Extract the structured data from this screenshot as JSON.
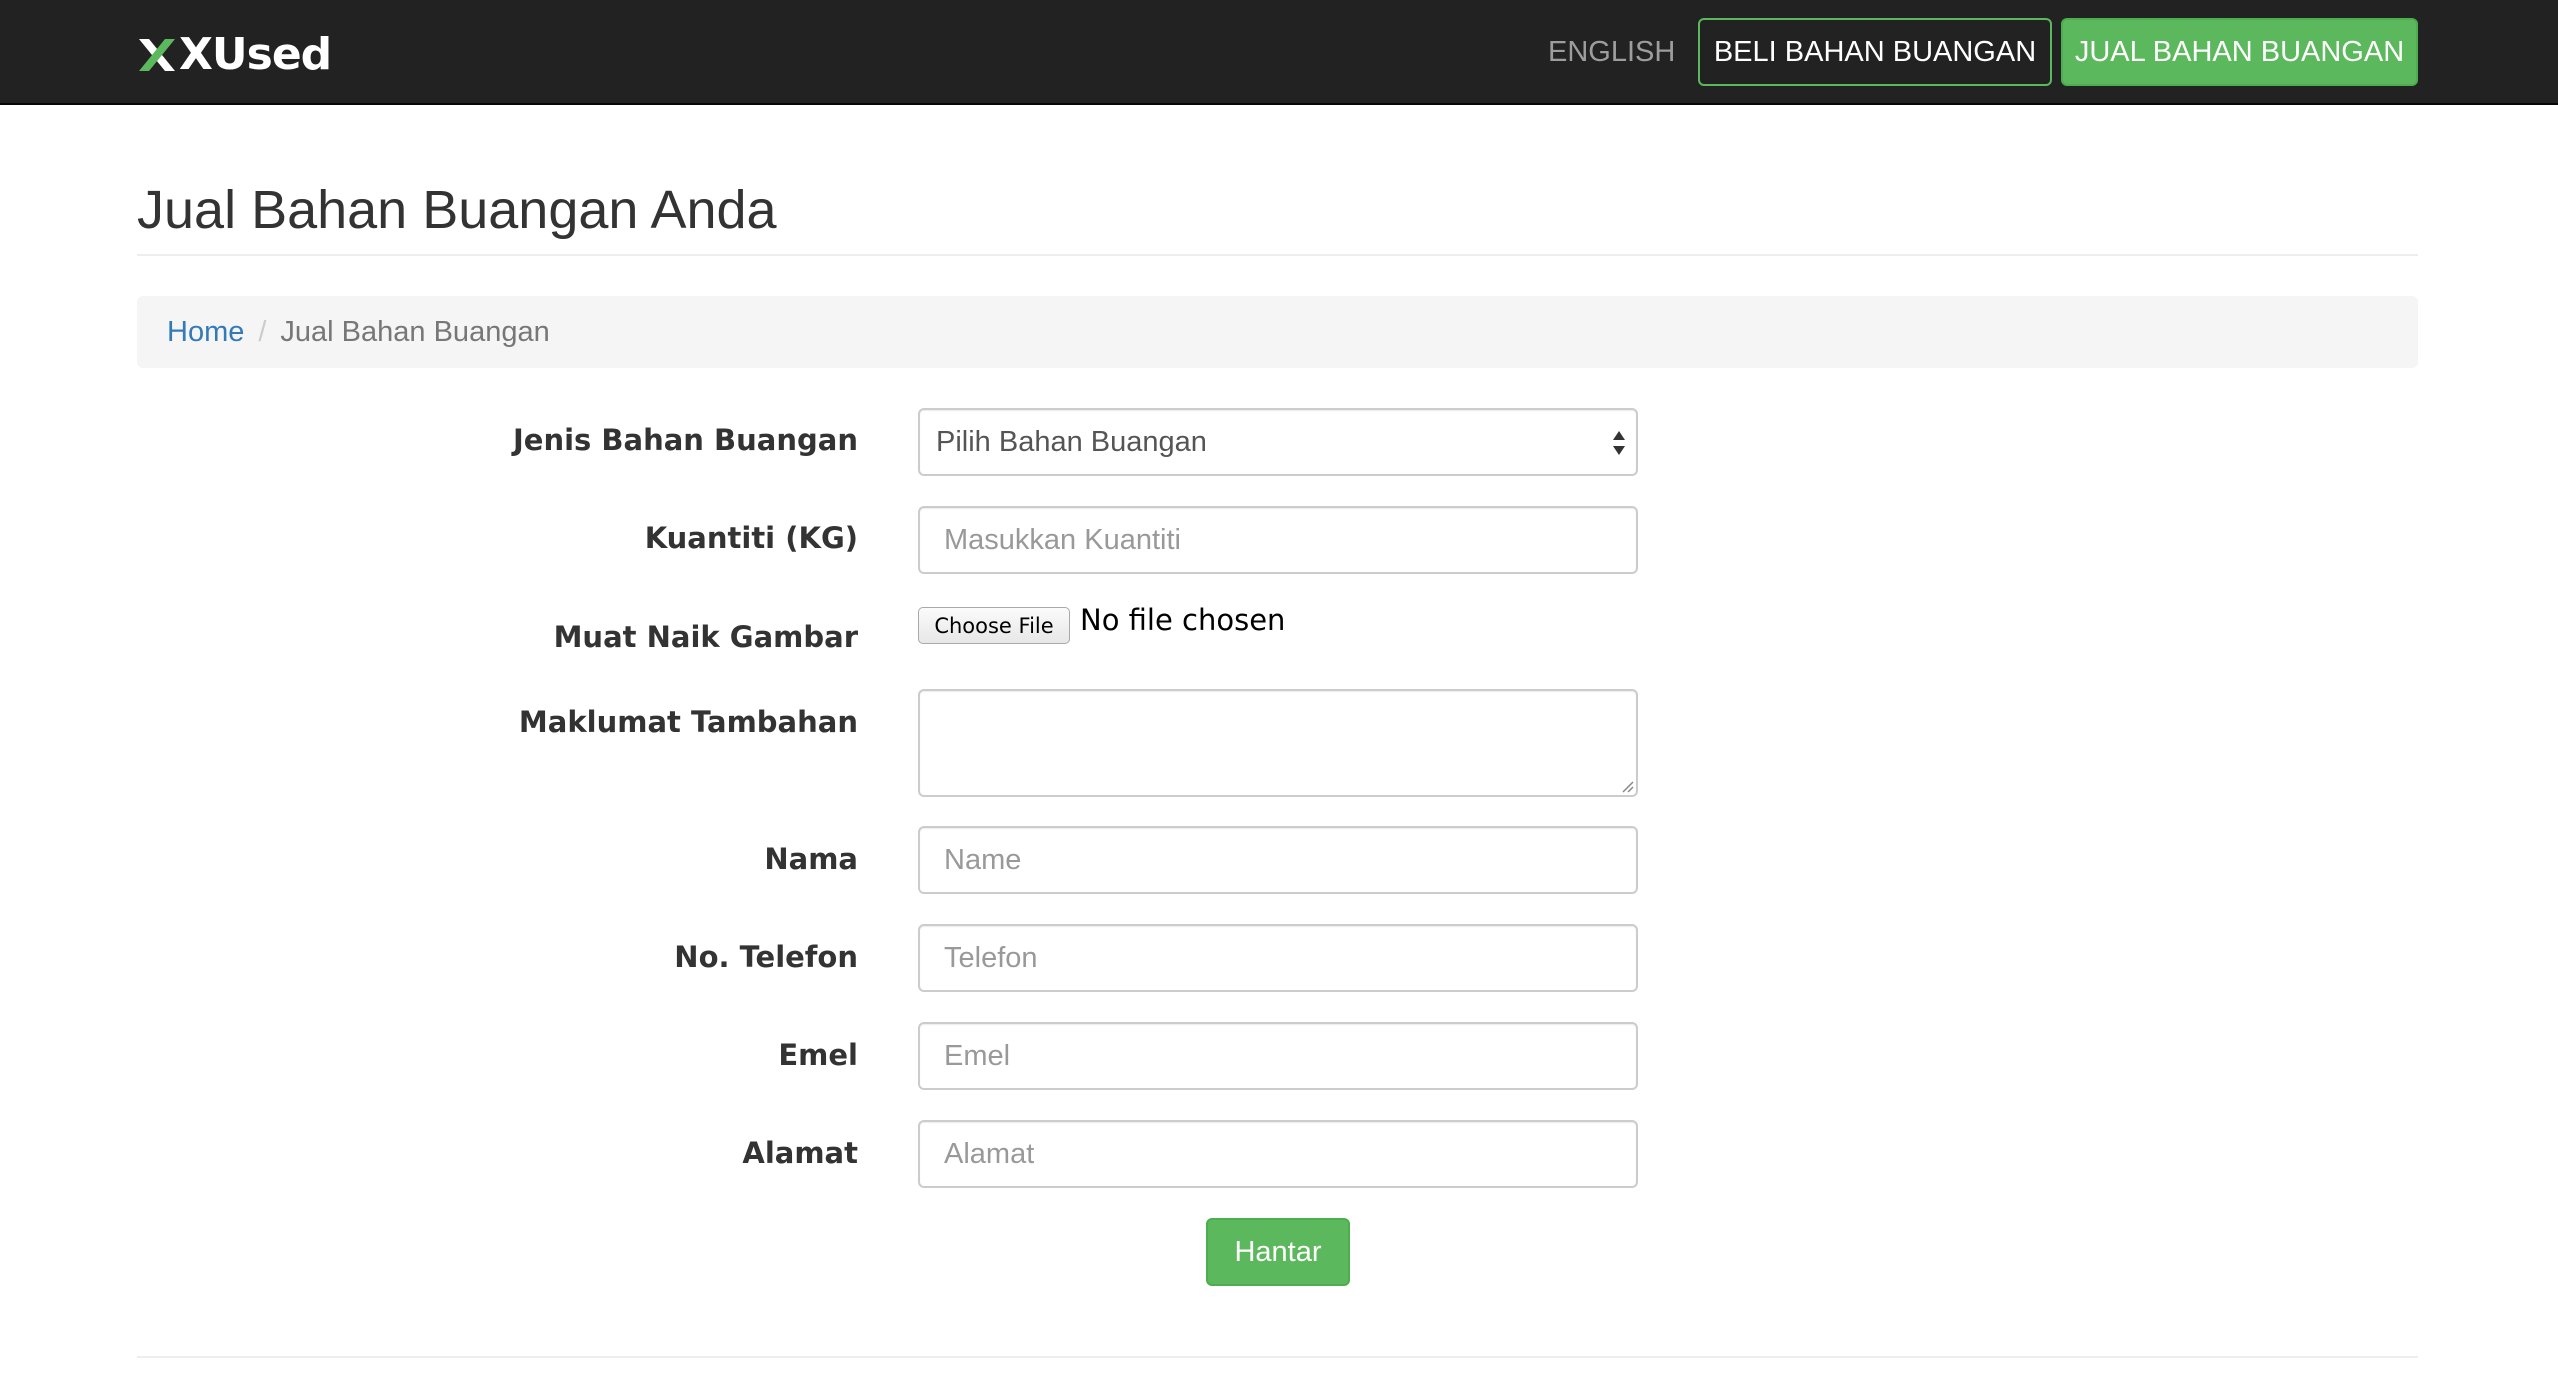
{
  "navbar": {
    "brand": "XUsed",
    "language_link": "ENGLISH",
    "buy_button": "BELI BAHAN BUANGAN",
    "sell_button": "JUAL BAHAN BUANGAN",
    "colors": {
      "background": "#222222",
      "accent": "#5cb85c",
      "muted": "#9d9d9d"
    }
  },
  "page": {
    "title": "Jual Bahan Buangan Anda"
  },
  "breadcrumb": {
    "home": "Home",
    "separator": "/",
    "current": "Jual Bahan Buangan"
  },
  "form": {
    "waste_type": {
      "label": "Jenis Bahan Buangan",
      "selected": "Pilih Bahan Buangan"
    },
    "quantity": {
      "label": "Kuantiti (KG)",
      "placeholder": "Masukkan Kuantiti",
      "value": ""
    },
    "upload": {
      "label": "Muat Naik Gambar",
      "button": "Choose File",
      "status": "No file chosen"
    },
    "extra_info": {
      "label": "Maklumat Tambahan",
      "value": ""
    },
    "name": {
      "label": "Nama",
      "placeholder": "Name",
      "value": ""
    },
    "phone": {
      "label": "No. Telefon",
      "placeholder": "Telefon",
      "value": ""
    },
    "email": {
      "label": "Emel",
      "placeholder": "Emel",
      "value": ""
    },
    "address": {
      "label": "Alamat",
      "placeholder": "Alamat",
      "value": ""
    },
    "submit": "Hantar"
  }
}
